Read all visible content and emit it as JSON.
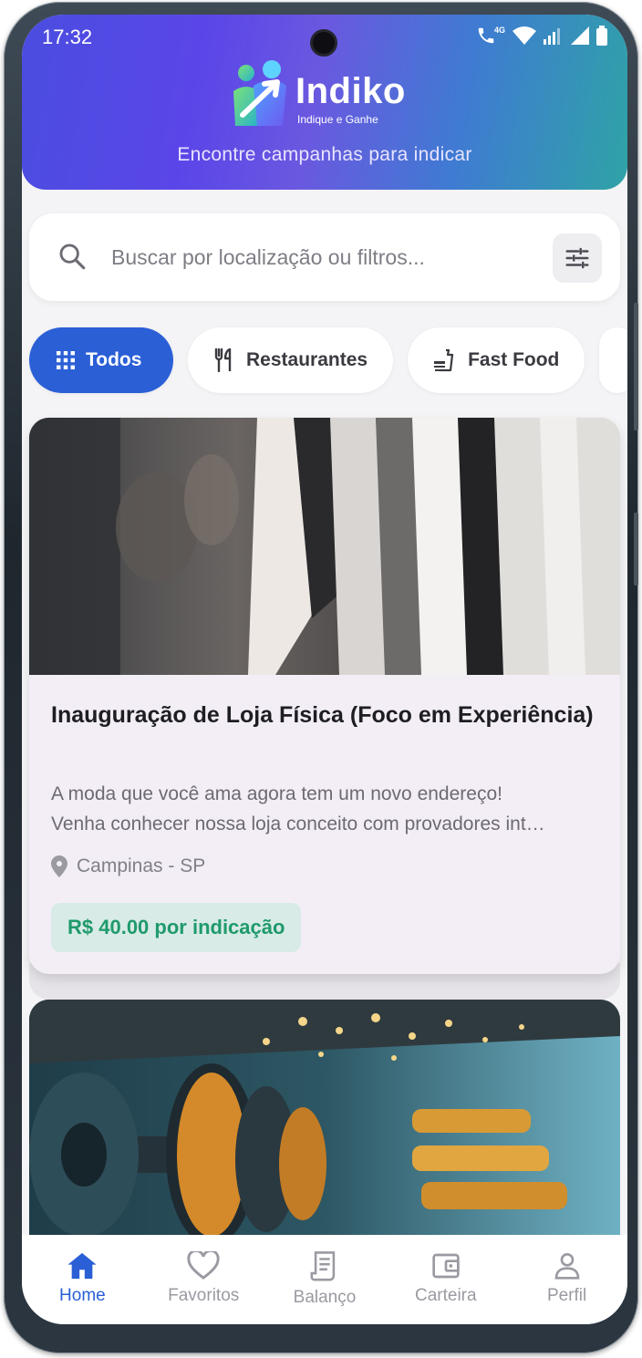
{
  "status_bar": {
    "time": "17:32",
    "network": "4G"
  },
  "header": {
    "logo_name": "Indiko",
    "logo_tagline": "Indique e Ganhe",
    "subtitle": "Encontre campanhas para indicar"
  },
  "search": {
    "placeholder": "Buscar por localização ou filtros..."
  },
  "categories": [
    {
      "label": "Todos",
      "icon": "grid-icon",
      "active": true
    },
    {
      "label": "Restaurantes",
      "icon": "utensils-icon",
      "active": false
    },
    {
      "label": "Fast Food",
      "icon": "fastfood-icon",
      "active": false
    }
  ],
  "campaigns": [
    {
      "image": "clothing-store-photo",
      "title": "Inauguração de Loja Física (Foco em Experiência)",
      "description_line1": "A moda que você ama agora tem um novo endereço!",
      "description_line2": "Venha conhecer nossa loja conceito com provadores int…",
      "location": "Campinas - SP",
      "reward": "R$ 40.00 por indicação"
    },
    {
      "image": "gym-dumbbells-photo"
    }
  ],
  "bottom_nav": [
    {
      "label": "Home",
      "icon": "home-icon",
      "active": true
    },
    {
      "label": "Favoritos",
      "icon": "heart-icon",
      "active": false
    },
    {
      "label": "Balanço",
      "icon": "receipt-icon",
      "active": false
    },
    {
      "label": "Carteira",
      "icon": "wallet-icon",
      "active": false
    },
    {
      "label": "Perfil",
      "icon": "person-icon",
      "active": false
    }
  ],
  "colors": {
    "primary": "#2a5fd6",
    "reward_green": "#1f9a6c",
    "reward_bg": "#d8ebe6"
  }
}
